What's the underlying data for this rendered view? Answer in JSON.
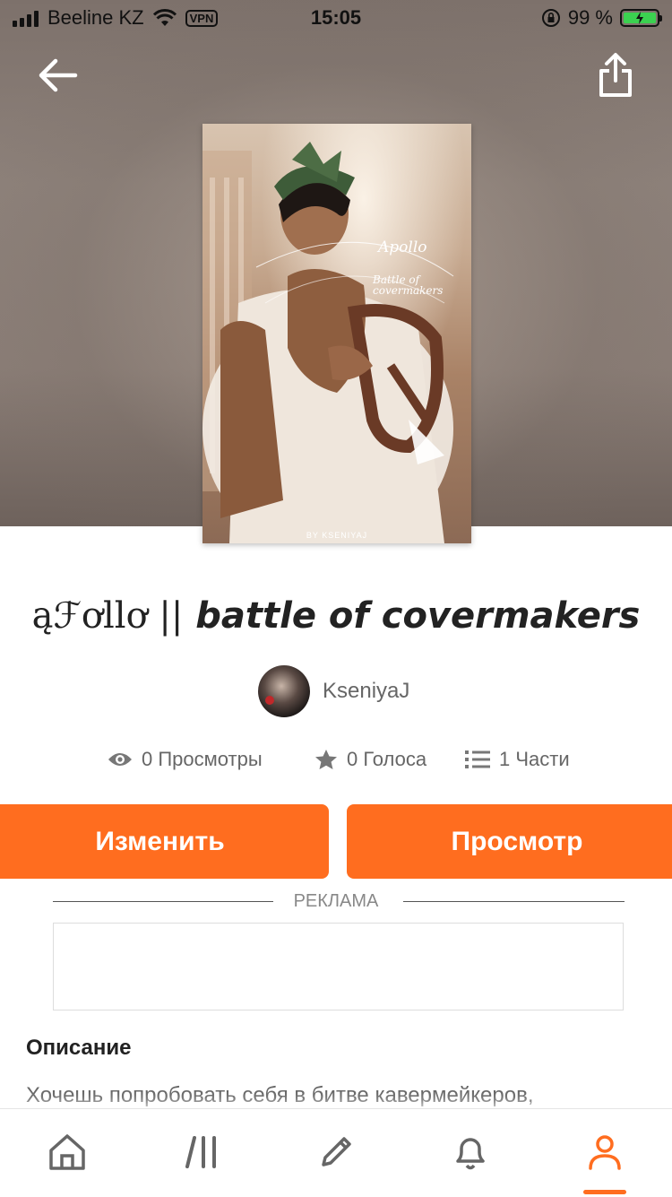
{
  "status_bar": {
    "carrier": "Beeline KZ",
    "vpn": "VPN",
    "time": "15:05",
    "battery": "99 %",
    "battery_level": 0.99
  },
  "cover": {
    "script_title": "Apollo",
    "script_sub": "Battle of covermakers",
    "credit": "BY KSENIYAJ"
  },
  "story": {
    "title_part1": "ąℱơllơ ||",
    "title_part2": " battle of covermakers",
    "author": "KseniyaJ"
  },
  "stats": {
    "views": "0 Просмотры",
    "votes": "0 Голоса",
    "parts": "1 Части"
  },
  "actions": {
    "edit": "Изменить",
    "view": "Просмотр"
  },
  "ad": {
    "label": "РЕКЛАМА"
  },
  "description": {
    "heading": "Описание",
    "text": "Хочешь попробовать себя в битве кавермейкеров,"
  },
  "colors": {
    "accent": "#ff6d1f",
    "text_secondary": "#666666"
  },
  "tabbar": {
    "icons": [
      "home-icon",
      "library-icon",
      "write-icon",
      "notifications-icon",
      "profile-icon"
    ],
    "active": "profile-icon"
  }
}
